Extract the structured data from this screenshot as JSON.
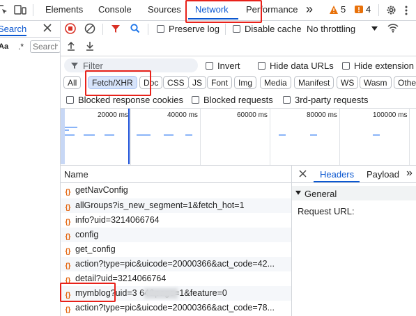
{
  "toolbar_top": {
    "tabs": [
      "Elements",
      "Console",
      "Sources",
      "Network",
      "Performance"
    ],
    "more": "»",
    "warnings": "5",
    "issues": "4"
  },
  "left_panel": {
    "search_label": "Search",
    "match_case": "Aa",
    "regex": ".*",
    "search_placeholder": "Search"
  },
  "net_toolbar": {
    "preserve_log": "Preserve log",
    "disable_cache": "Disable cache",
    "throttling": "No throttling"
  },
  "filter": {
    "placeholder": "Filter",
    "invert": "Invert",
    "hide_data_urls": "Hide data URLs",
    "hide_extension": "Hide extension"
  },
  "type_chips": [
    "All",
    "Fetch/XHR",
    "Doc",
    "CSS",
    "JS",
    "Font",
    "Img",
    "Media",
    "Manifest",
    "WS",
    "Wasm",
    "Other"
  ],
  "blocked": {
    "response_cookies": "Blocked response cookies",
    "requests": "Blocked requests",
    "third_party": "3rd-party requests"
  },
  "timeline": {
    "ticks": [
      "20000 ms",
      "40000 ms",
      "60000 ms",
      "80000 ms",
      "100000 ms"
    ]
  },
  "requests": {
    "header": "Name",
    "rows": [
      "getNavConfig",
      "allGroups?is_new_segment=1&fetch_hot=1",
      "info?uid=3214066764",
      "config",
      "get_config",
      "action?type=pic&uicode=20000366&act_code=42...",
      "detail?uid=3214066764",
      "mymblog?uid=3          64&page=1&feature=0",
      "action?type=pic&uicode=20000366&act_code=78..."
    ]
  },
  "details": {
    "tabs": [
      "Headers",
      "Payload"
    ],
    "section": "General",
    "request_url_label": "Request URL:"
  }
}
